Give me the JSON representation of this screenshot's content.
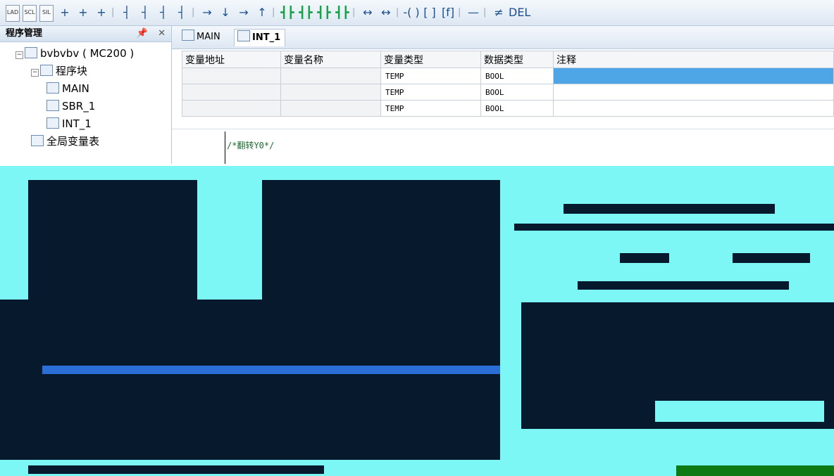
{
  "toolbar": {
    "items": [
      {
        "label": "LAD"
      },
      {
        "label": "SCL"
      },
      {
        "label": "SIL"
      },
      {
        "label": "+"
      },
      {
        "label": "+"
      },
      {
        "label": "+"
      },
      {
        "label": "|"
      },
      {
        "label": "┤"
      },
      {
        "label": "┤"
      },
      {
        "label": "┤"
      },
      {
        "label": "┤"
      },
      {
        "label": "|"
      },
      {
        "label": "→"
      },
      {
        "label": "↓"
      },
      {
        "label": "→"
      },
      {
        "label": "↑"
      },
      {
        "label": "|"
      },
      {
        "label": "┫┣"
      },
      {
        "label": "┫┣"
      },
      {
        "label": "┫┣"
      },
      {
        "label": "┫┣"
      },
      {
        "label": "|"
      },
      {
        "label": "↔"
      },
      {
        "label": "↔"
      },
      {
        "label": "|"
      },
      {
        "label": "-( )"
      },
      {
        "label": "[ ]"
      },
      {
        "label": "[f]"
      },
      {
        "label": "|"
      },
      {
        "label": "—"
      },
      {
        "label": "|"
      },
      {
        "label": "≠"
      },
      {
        "label": "DEL"
      }
    ]
  },
  "left_pane": {
    "title": "程序管理",
    "pin_icon": "pin-icon",
    "close_icon": "close-icon",
    "tree": [
      {
        "label": "bvbvbv ( MC200 )",
        "icon": "project-icon",
        "indent": 0,
        "expander": "−"
      },
      {
        "label": "程序块",
        "icon": "program-block-icon",
        "indent": 1,
        "expander": "−"
      },
      {
        "label": "MAIN",
        "icon": "main-program-icon",
        "indent": 2
      },
      {
        "label": "SBR_1",
        "icon": "subroutine-icon",
        "indent": 2
      },
      {
        "label": "INT_1",
        "icon": "interrupt-icon",
        "indent": 2
      },
      {
        "label": "全局变量表",
        "icon": "global-variables-icon",
        "indent": 1
      }
    ]
  },
  "tabs": [
    {
      "label": "MAIN",
      "icon": "main-program-icon",
      "active": false
    },
    {
      "label": "INT_1",
      "icon": "interrupt-icon",
      "active": true
    }
  ],
  "variable_table": {
    "headers": [
      "变量地址",
      "变量名称",
      "变量类型",
      "数据类型",
      "注释"
    ],
    "rows": [
      [
        "",
        "",
        "TEMP",
        "BOOL",
        ""
      ],
      [
        "",
        "",
        "TEMP",
        "BOOL",
        ""
      ],
      [
        "",
        "",
        "TEMP",
        "BOOL",
        ""
      ]
    ]
  },
  "editor": {
    "code_line": "/*翻转Y0*/"
  },
  "colors": {
    "selected_cell": "#4ea6e6",
    "corrupted_dark": "#07192d",
    "corrupted_cyan": "#7df7f5"
  }
}
